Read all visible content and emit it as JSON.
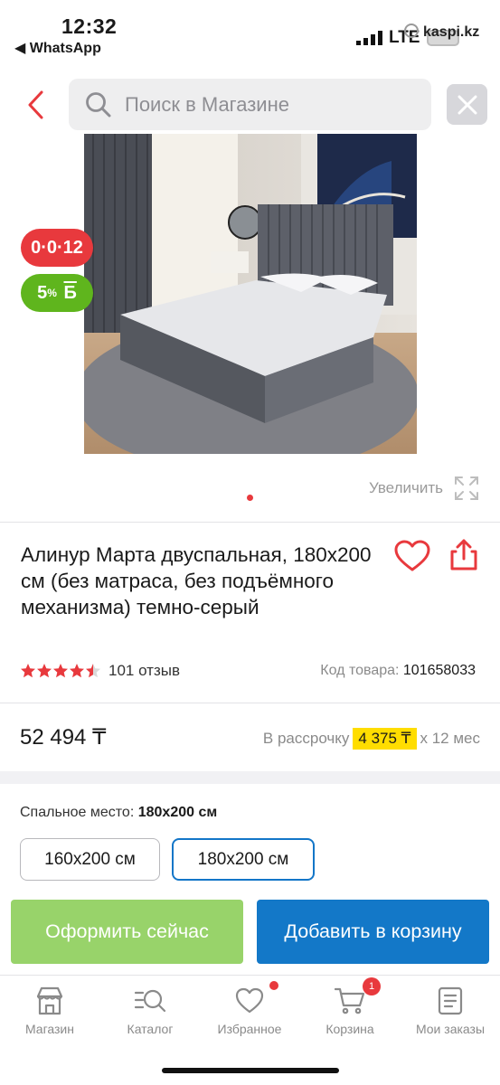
{
  "status_bar": {
    "time": "12:32",
    "back_app": "◀ WhatsApp",
    "network": "LTE",
    "url": "kaspi.kz"
  },
  "search": {
    "placeholder": "Поиск в Магазине"
  },
  "icons": {
    "back": "chevron-left-icon",
    "search": "search-icon",
    "clear": "close-icon",
    "zoom": "expand-icon",
    "favorite": "heart-icon",
    "share": "share-icon",
    "star": "star-icon"
  },
  "badges": {
    "credit": "0·0·12",
    "bonus_value": "5",
    "bonus_unit": "%",
    "bonus_symbol": "Б"
  },
  "gallery": {
    "zoom_label": "Увеличить",
    "active_index": 0,
    "total": 1
  },
  "product": {
    "title": "Алинур Марта двуспальная, 180x200 см (без матраса, без подъёмного механизма) темно-серый",
    "rating": 4.5,
    "reviews": "101 отзыв",
    "code_label": "Код товара:",
    "code_value": "101658033",
    "price": "52 494 ₸",
    "installment_prefix": "В рассрочку",
    "installment_amount": "4 375 ₸",
    "installment_suffix": "x 12 мес"
  },
  "options": {
    "label": "Спальное место:",
    "selected": "180x200 см",
    "items": [
      "160x200 см",
      "180x200 см"
    ]
  },
  "actions": {
    "checkout": "Оформить сейчас",
    "add_to_cart": "Добавить в корзину"
  },
  "tabs": [
    {
      "label": "Магазин",
      "icon": "store-icon"
    },
    {
      "label": "Каталог",
      "icon": "catalog-search-icon"
    },
    {
      "label": "Избранное",
      "icon": "heart-icon"
    },
    {
      "label": "Корзина",
      "icon": "cart-icon",
      "badge": "1"
    },
    {
      "label": "Мои заказы",
      "icon": "orders-icon"
    }
  ],
  "colors": {
    "accent_red": "#e8393d",
    "bonus_green": "#5fb51d",
    "checkout_green": "#98d36a",
    "cart_blue": "#1378c8",
    "installment_yellow": "#ffdd00"
  }
}
